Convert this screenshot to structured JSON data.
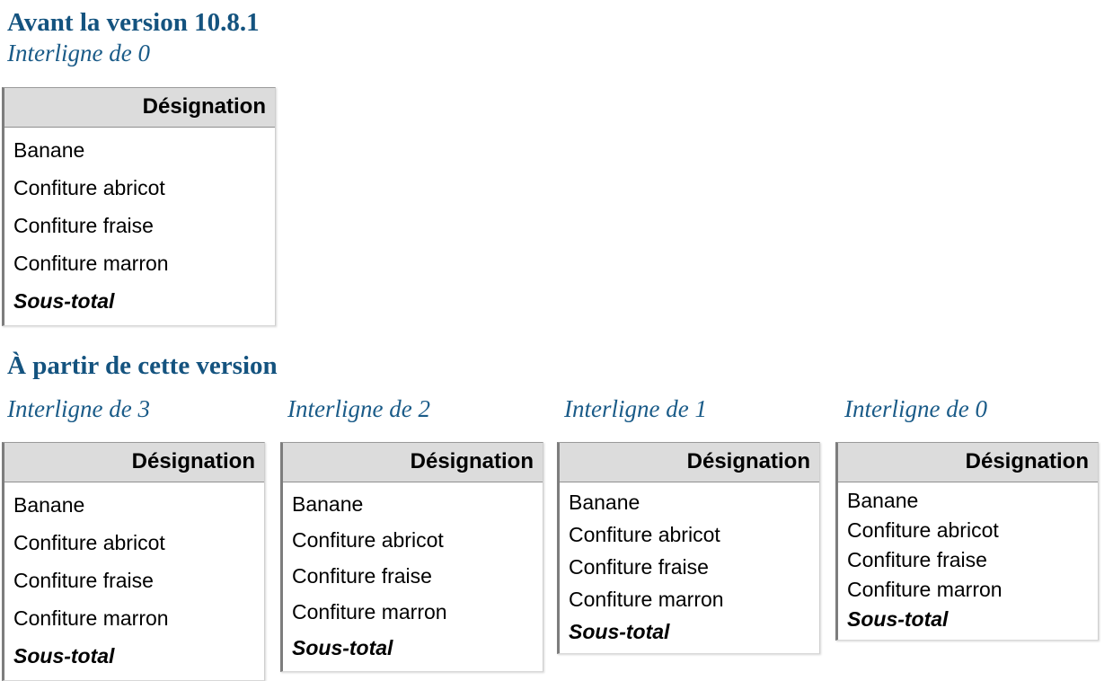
{
  "legacy": {
    "title": "Avant la version 10.8.1",
    "subtitle": "Interligne de 0",
    "table": {
      "header": "Désignation",
      "rows": [
        "Banane",
        "Confiture abricot",
        "Confiture fraise",
        "Confiture marron"
      ],
      "total_row": "Sous-total"
    }
  },
  "current": {
    "title": "À partir de cette version",
    "columns": [
      {
        "subtitle": "Interligne de 3",
        "spacing": 3,
        "table": {
          "header": "Désignation",
          "rows": [
            "Banane",
            "Confiture abricot",
            "Confiture fraise",
            "Confiture marron"
          ],
          "total_row": "Sous-total"
        }
      },
      {
        "subtitle": "Interligne de 2",
        "spacing": 2,
        "table": {
          "header": "Désignation",
          "rows": [
            "Banane",
            "Confiture abricot",
            "Confiture fraise",
            "Confiture marron"
          ],
          "total_row": "Sous-total"
        }
      },
      {
        "subtitle": "Interligne de 1",
        "spacing": 1,
        "table": {
          "header": "Désignation",
          "rows": [
            "Banane",
            "Confiture abricot",
            "Confiture fraise",
            "Confiture marron"
          ],
          "total_row": "Sous-total"
        }
      },
      {
        "subtitle": "Interligne de 0",
        "spacing": 0,
        "table": {
          "header": "Désignation",
          "rows": [
            "Banane",
            "Confiture abricot",
            "Confiture fraise",
            "Confiture marron"
          ],
          "total_row": "Sous-total"
        }
      }
    ]
  },
  "colors": {
    "heading_blue": "#14537f",
    "subtitle_blue": "#1a5b88",
    "table_header_bg": "#dcdcdc",
    "table_border": "#7d7d7d",
    "text": "#000000",
    "background": "#ffffff"
  }
}
